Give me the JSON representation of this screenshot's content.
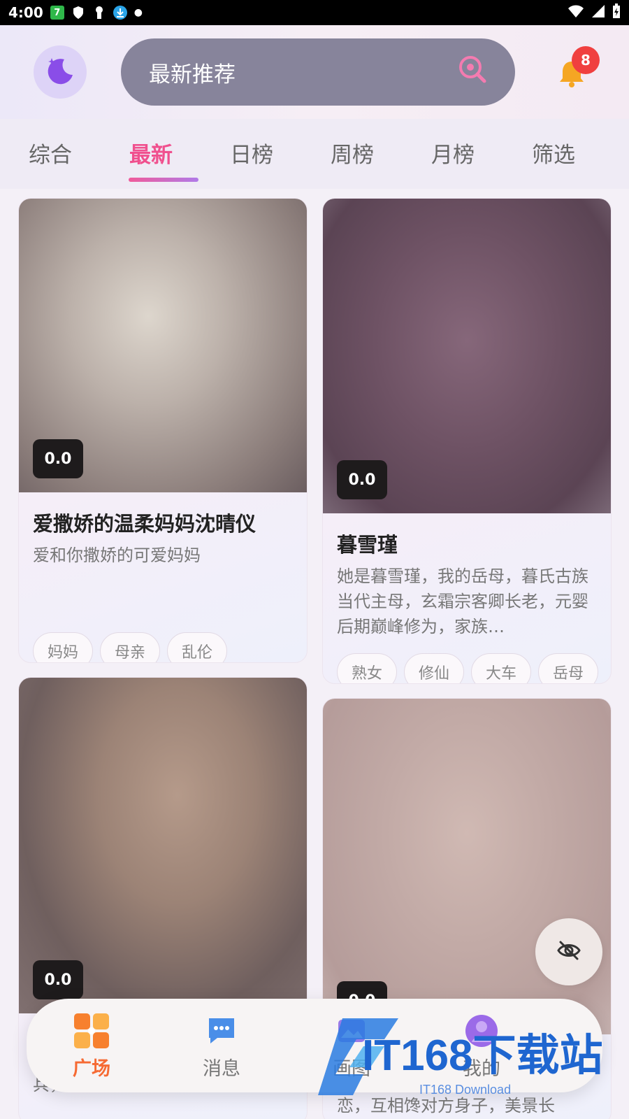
{
  "status_bar": {
    "time": "4:00",
    "app_badge": "7"
  },
  "header": {
    "search_text": "最新推荐",
    "notification_count": "8"
  },
  "tabs": [
    {
      "label": "综合"
    },
    {
      "label": "最新"
    },
    {
      "label": "日榜"
    },
    {
      "label": "周榜"
    },
    {
      "label": "月榜"
    },
    {
      "label": "筛选"
    }
  ],
  "active_tab": "最新",
  "cards": [
    {
      "score": "0.0",
      "title": "爱撒娇的温柔妈妈沈晴仪",
      "desc": "爱和你撒娇的可爱妈妈",
      "tags": [
        "妈妈",
        "母亲",
        "乱伦"
      ]
    },
    {
      "score": "0.0",
      "title": "暮雪瑾",
      "desc": "她是暮雪瑾，我的岳母，暮氏古族当代主母，玄霜宗客卿长老，元婴后期巅峰修为，家族…",
      "tags": [
        "熟女",
        "修仙",
        "大车",
        "岳母"
      ]
    },
    {
      "score": "0.0",
      "desc_partial": "兵，没有什么恋爱史。外表御"
    },
    {
      "score": "0.0",
      "desc_partial": "恋，互相馋对方身子，美景长"
    }
  ],
  "bottom_nav": [
    {
      "label": "广场",
      "icon": "grid-icon"
    },
    {
      "label": "消息",
      "icon": "chat-icon"
    },
    {
      "label": "画图",
      "icon": "image-icon"
    },
    {
      "label": "我的",
      "icon": "user-icon"
    }
  ],
  "watermark": {
    "text": "IT168下载站",
    "sub": "IT168 Download"
  },
  "colors": {
    "accent": "#f0508e",
    "nav_active": "#f66a33",
    "badge": "#f0403f"
  }
}
